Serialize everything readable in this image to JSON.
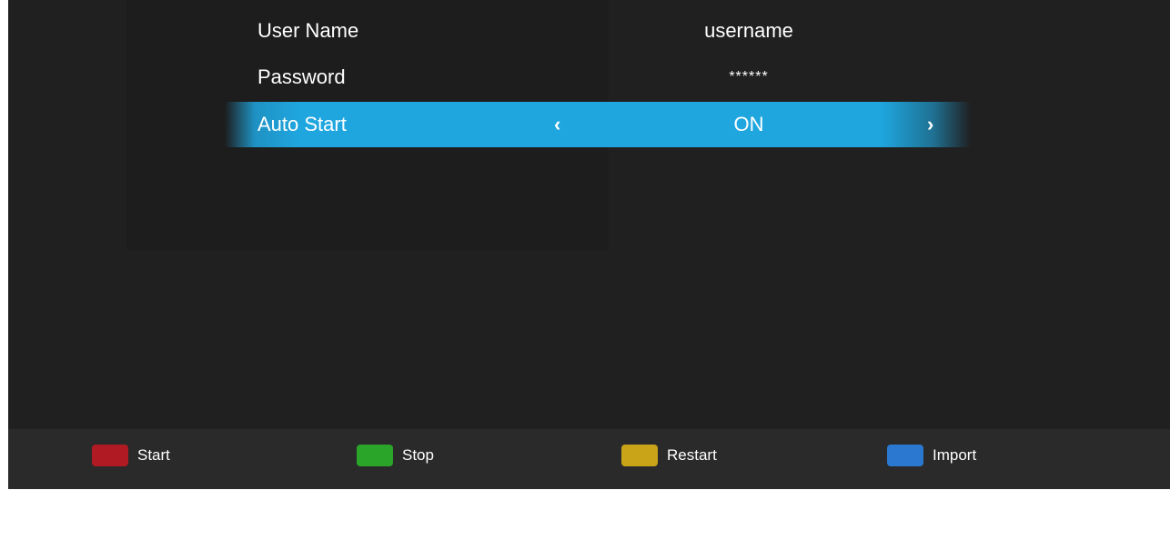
{
  "settings": {
    "rows": [
      {
        "label": "User Name",
        "value": "username"
      },
      {
        "label": "Password",
        "value": "******"
      },
      {
        "label": "Auto Start",
        "value": "ON",
        "left_arrow": "‹",
        "right_arrow": "›"
      }
    ]
  },
  "footer": {
    "buttons": [
      {
        "label": "Start",
        "color": "#b01a22"
      },
      {
        "label": "Stop",
        "color": "#2aa52a"
      },
      {
        "label": "Restart",
        "color": "#c9a418"
      },
      {
        "label": "Import",
        "color": "#2a78d0"
      }
    ]
  },
  "colors": {
    "background": "#202020",
    "highlight": "#1fa6df",
    "footer_bg": "#2a2a2a"
  }
}
